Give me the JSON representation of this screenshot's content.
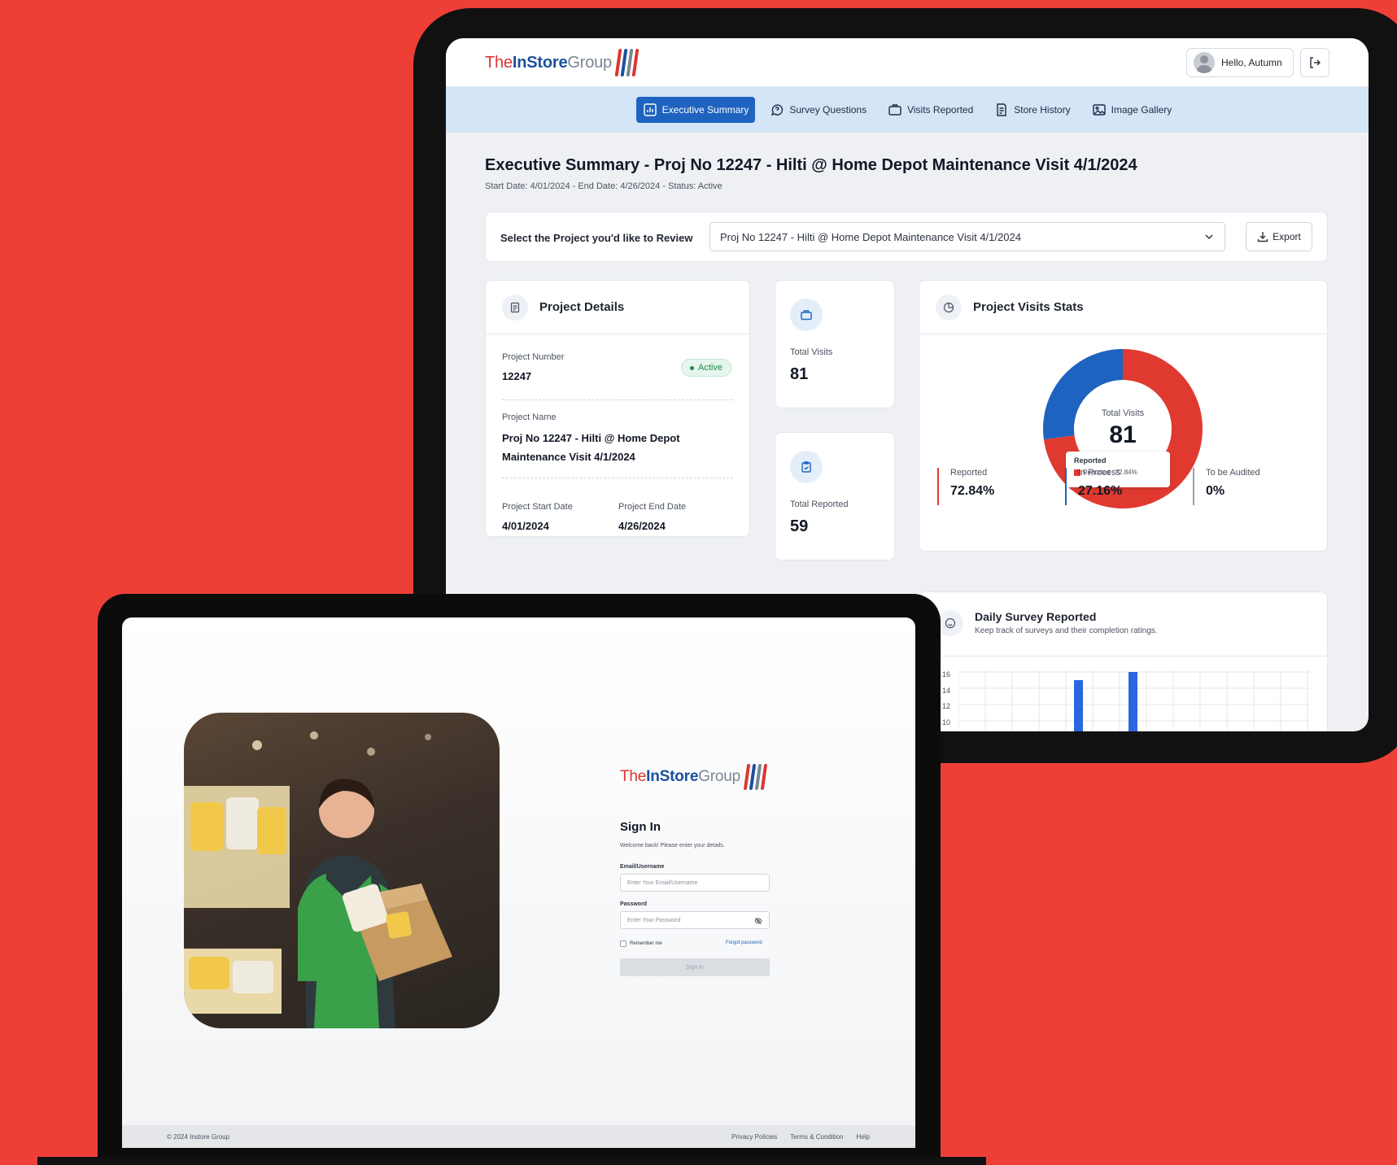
{
  "brand": {
    "logo_the": "The",
    "logo_instore": "InStore",
    "logo_group": "Group",
    "colors": {
      "red": "#d9372f",
      "blue": "#1d4f9e",
      "background": "#ee3f37",
      "accent": "#1e63bf"
    }
  },
  "dashboard": {
    "user_greeting": "Hello, Autumn",
    "nav": [
      {
        "label": "Executive Summary",
        "icon": "chart-icon",
        "active": true
      },
      {
        "label": "Survey Questions",
        "icon": "chat-question-icon",
        "active": false
      },
      {
        "label": "Visits Reported",
        "icon": "briefcase-icon",
        "active": false
      },
      {
        "label": "Store History",
        "icon": "document-icon",
        "active": false
      },
      {
        "label": "Image Gallery",
        "icon": "image-icon",
        "active": false
      }
    ],
    "title": "Executive Summary - Proj No 12247 - Hilti @ Home Depot Maintenance Visit 4/1/2024",
    "subtitle": "Start Date: 4/01/2024 - End Date: 4/26/2024 - Status: Active",
    "select_label": "Select the Project you'd like to Review",
    "select_value": "Proj No 12247 - Hilti @ Home Depot Maintenance Visit 4/1/2024",
    "export_label": "Export",
    "project_details": {
      "heading": "Project Details",
      "number_label": "Project Number",
      "number_value": "12247",
      "status": "Active",
      "name_label": "Project Name",
      "name_line1": "Proj No 12247 - Hilti @ Home Depot",
      "name_line2": "Maintenance Visit 4/1/2024",
      "start_label": "Project Start Date",
      "start_value": "4/01/2024",
      "end_label": "Project End Date",
      "end_value": "4/26/2024"
    },
    "total_visits": {
      "label": "Total Visits",
      "value": "81"
    },
    "total_reported": {
      "label": "Total Reported",
      "value": "59"
    },
    "visit_stats": {
      "heading": "Project Visits Stats",
      "center_label": "Total Visits",
      "center_value": "81",
      "tooltip_title": "Reported",
      "tooltip_text": "Reported : 72.84%",
      "items": [
        {
          "label": "Reported",
          "value": "72.84%",
          "color": "#e03a30"
        },
        {
          "label": "In Process",
          "value": "27.16%",
          "color": "#1e63bf"
        },
        {
          "label": "To be Audited",
          "value": "0%",
          "color": "#9aa1ac"
        }
      ]
    },
    "daily_survey": {
      "heading": "Daily Survey Reported",
      "sub": "Keep track of surveys and their completion ratings.",
      "yticks": [
        "16",
        "14",
        "12",
        "10"
      ]
    }
  },
  "chart_data": {
    "type": "pie",
    "title": "Total Visits",
    "categories": [
      "Reported",
      "In Process",
      "To be Audited"
    ],
    "values": [
      72.84,
      27.16,
      0
    ],
    "colors": [
      "#e03a30",
      "#1e63bf",
      "#9aa1ac"
    ]
  },
  "login": {
    "title": "Sign In",
    "subtitle": "Welcome back! Please enter your details.",
    "email_label": "Email/Username",
    "email_placeholder": "Enter Your Email/Username",
    "password_label": "Password",
    "password_placeholder": "Enter Your Password",
    "remember": "Remember me",
    "forgot": "Forgot password",
    "button": "Sign In",
    "footer_copy": "© 2024 Instore Group",
    "footer_links": [
      "Privacy Policies",
      "Terms & Condition",
      "Help"
    ]
  }
}
